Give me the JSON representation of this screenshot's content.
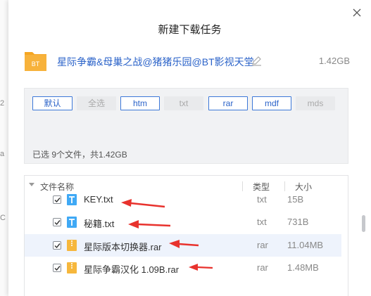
{
  "dialog": {
    "title": "新建下载任务",
    "task": {
      "name": "星际争霸&母巢之战@猪猪乐园@BT影视天堂",
      "folder_badge": "BT",
      "size": "1.42GB"
    }
  },
  "filters": [
    {
      "label": "默认",
      "active": true
    },
    {
      "label": "全选",
      "active": false
    },
    {
      "label": "htm",
      "active": true
    },
    {
      "label": "txt",
      "active": false
    },
    {
      "label": "rar",
      "active": true
    },
    {
      "label": "mdf",
      "active": true
    },
    {
      "label": "mds",
      "active": false
    }
  ],
  "selection_summary": "已选 9个文件，共1.42GB",
  "file_list": {
    "headers": {
      "name": "文件名称",
      "type": "类型",
      "size": "大小"
    },
    "rows": [
      {
        "name": "KEY.txt",
        "type": "txt",
        "size": "15B",
        "checked": true,
        "icon": "text-file-icon"
      },
      {
        "name": "秘籍.txt",
        "type": "txt",
        "size": "731B",
        "checked": true,
        "icon": "text-file-icon"
      },
      {
        "name": "星际版本切换器.rar",
        "type": "rar",
        "size": "11.04MB",
        "checked": true,
        "icon": "archive-file-icon",
        "highlighted": true
      },
      {
        "name": "星际争霸汉化 1.09B.rar",
        "type": "rar",
        "size": "1.48MB",
        "checked": true,
        "icon": "archive-file-icon"
      }
    ]
  },
  "background_glyphs": [
    "2",
    "a",
    "C"
  ],
  "colors": {
    "accent": "#2b63c9",
    "folder": "#f5a623",
    "text_file_icon": "#3fa9f5",
    "archive_icon": "#f6b73c",
    "annotation_arrow": "#e8322d",
    "highlight_row": "#eef3fc"
  }
}
